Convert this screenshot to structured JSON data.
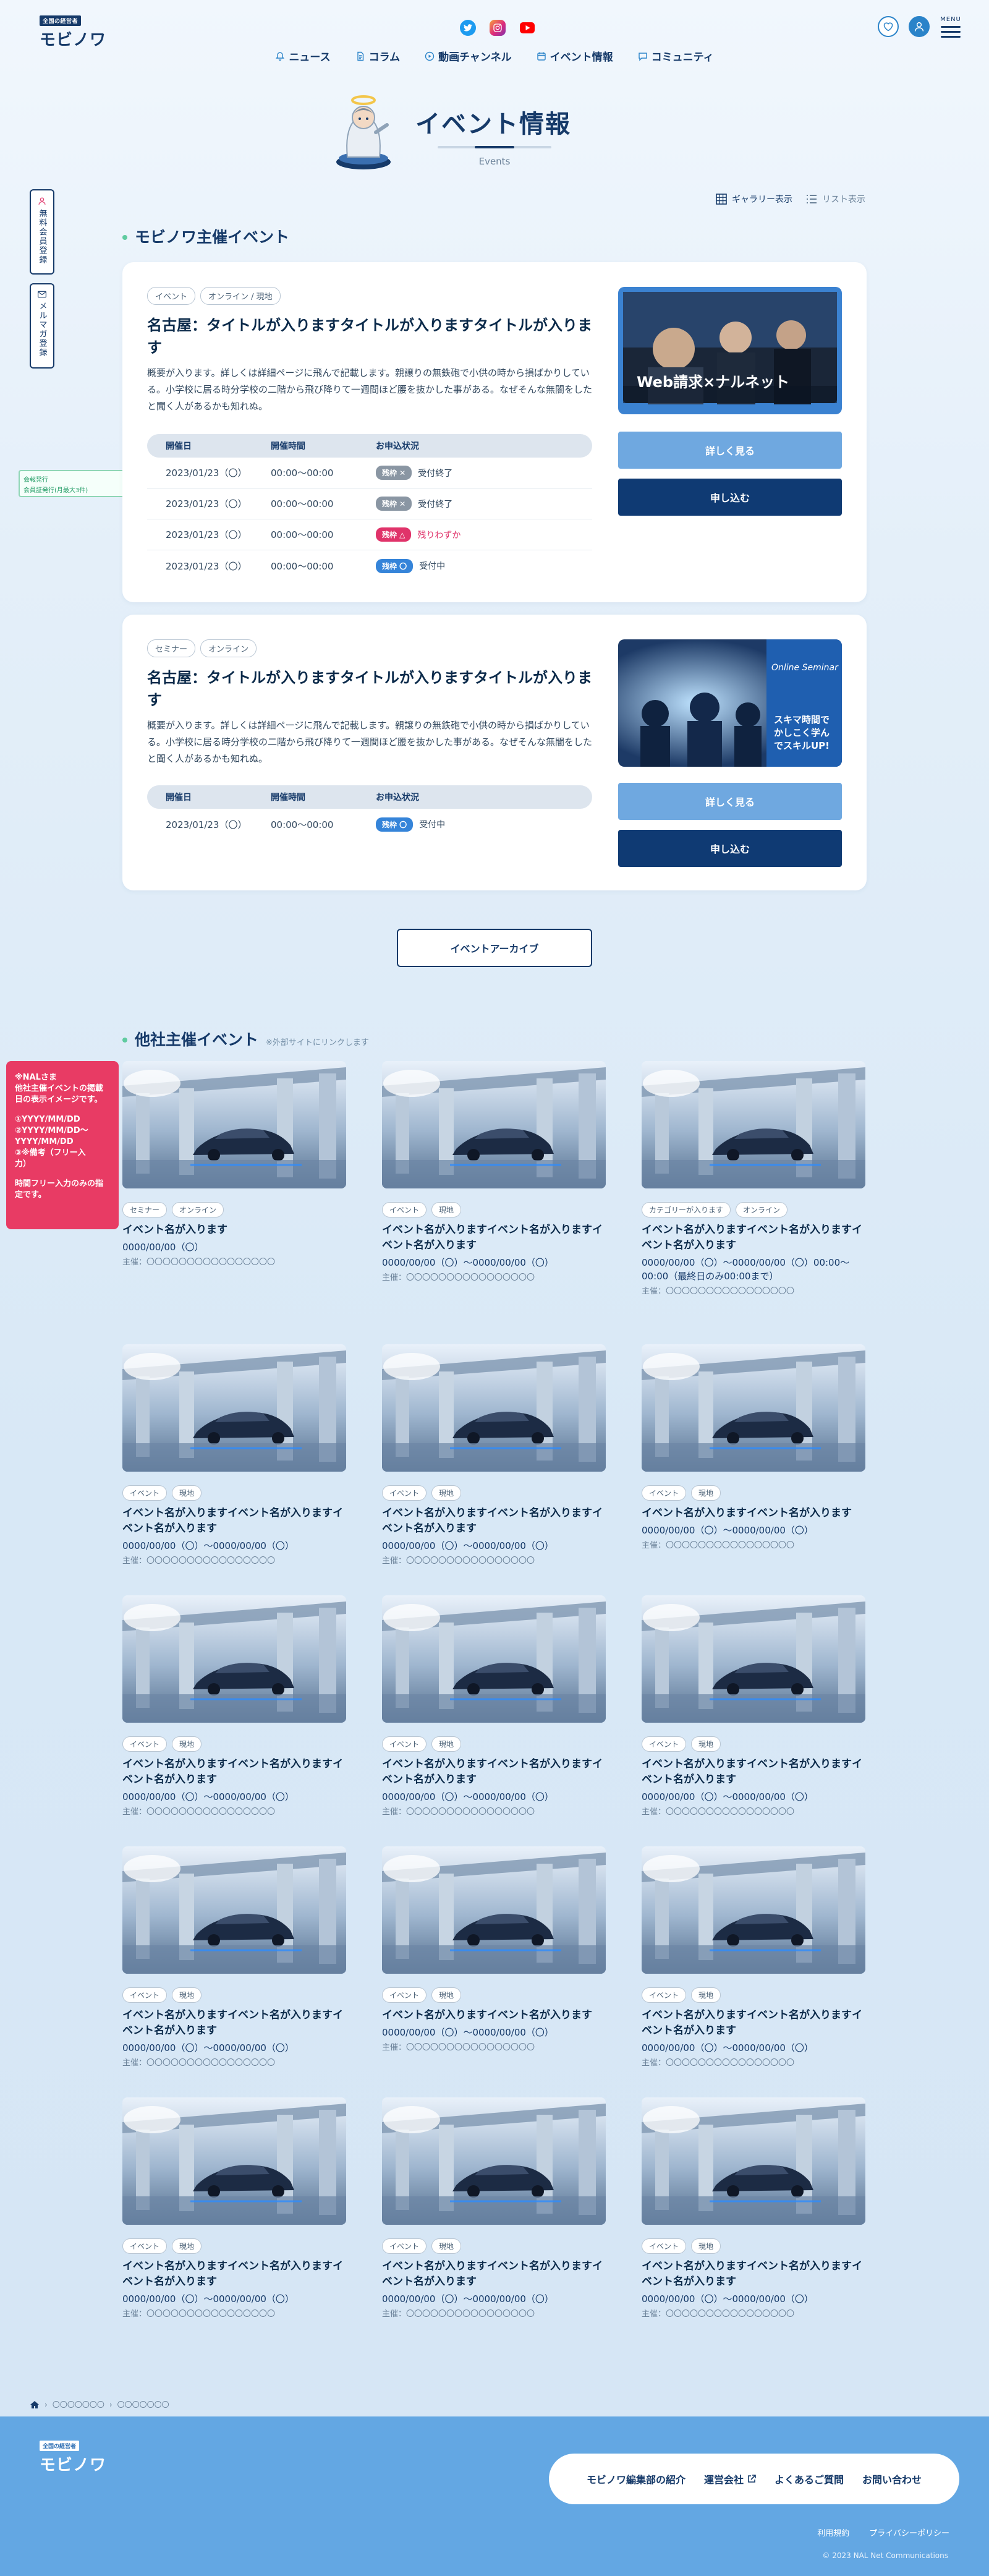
{
  "header": {
    "logo_small": "全国の経営者",
    "logo_main": "モビノワ",
    "nav": [
      "ニュース",
      "コラム",
      "動画チャンネル",
      "イベント情報",
      "コミュニティ"
    ],
    "menu_label": "MENU"
  },
  "hero": {
    "title": "イベント情報",
    "subtitle": "Events"
  },
  "side": {
    "tab1": "無料会員登録",
    "tab2": "メルマガ登録",
    "badge_line1": "会報発行",
    "badge_line2": "会員証発行(月最大3件)",
    "annotation": [
      "※NALさま",
      "他社主催イベントの掲載",
      "日の表示イメージです。",
      "",
      "①YYYY/MM/DD",
      "②YYYY/MM/DD〜",
      "YYYY/MM/DD",
      "③※備考（フリー入",
      "力）",
      "",
      "時間フリー入力のみの指",
      "定です。"
    ]
  },
  "view_toggle": {
    "gallery": "ギャラリー表示",
    "list": "リスト表示"
  },
  "own_events": {
    "heading": "モビノワ主催イベント",
    "detail_label": "詳しく見る",
    "apply_label": "申し込む",
    "table_headers": [
      "開催日",
      "開催時間",
      "お申込状況"
    ],
    "events": [
      {
        "tags": [
          "イベント",
          "オンライン / 現地"
        ],
        "title": "名古屋：タイトルが入りますタイトルが入りますタイトルが入ります",
        "description": "概要が入ります。詳しくは詳細ページに飛んで記載します。親譲りの無鉄砲で小供の時から損ばかりしている。小学校に居る時分学校の二階から飛び降りて一週間ほど腰を抜かした事がある。なぜそんな無闇をしたと聞く人があるかも知れぬ。",
        "image_text": "Web請求×ナルネット",
        "rows": [
          {
            "date": "2023/01/23（〇）",
            "time": "00:00〜00:00",
            "badge": "残枠 ✕",
            "badge_color": "gray",
            "status": "受付終了"
          },
          {
            "date": "2023/01/23（〇）",
            "time": "00:00〜00:00",
            "badge": "残枠 ✕",
            "badge_color": "gray",
            "status": "受付終了"
          },
          {
            "date": "2023/01/23（〇）",
            "time": "00:00〜00:00",
            "badge": "残枠 △",
            "badge_color": "red",
            "status": "残りわずか"
          },
          {
            "date": "2023/01/23（〇）",
            "time": "00:00〜00:00",
            "badge": "残枠 〇",
            "badge_color": "blue",
            "status": "受付中"
          }
        ]
      },
      {
        "tags": [
          "セミナー",
          "オンライン"
        ],
        "title": "名古屋：タイトルが入りますタイトルが入りますタイトルが入ります",
        "description": "概要が入ります。詳しくは詳細ページに飛んで記載します。親譲りの無鉄砲で小供の時から損ばかりしている。小学校に居る時分学校の二階から飛び降りて一週間ほど腰を抜かした事がある。なぜそんな無闇をしたと聞く人があるかも知れぬ。",
        "image_text_top": "Online Seminar",
        "image_text": "スキマ時間でかしこく学んでスキルUP!",
        "rows": [
          {
            "date": "2023/01/23（〇）",
            "time": "00:00〜00:00",
            "badge": "残枠 〇",
            "badge_color": "blue",
            "status": "受付中"
          }
        ]
      }
    ],
    "archive_label": "イベントアーカイブ"
  },
  "external_events": {
    "heading": "他社主催イベント",
    "note": "※外部サイトにリンクします",
    "cards": [
      {
        "tags": [
          "セミナー",
          "オンライン"
        ],
        "title": "イベント名が入ります",
        "date": "0000/00/00（〇）",
        "org": "主催：〇〇〇〇〇〇〇〇〇〇〇〇〇〇〇〇"
      },
      {
        "tags": [
          "イベント",
          "現地"
        ],
        "title": "イベント名が入りますイベント名が入りますイベント名が入ります",
        "date": "0000/00/00（〇）〜0000/00/00（〇）",
        "org": "主催：〇〇〇〇〇〇〇〇〇〇〇〇〇〇〇〇"
      },
      {
        "tags": [
          "カテゴリーが入ります",
          "オンライン"
        ],
        "title": "イベント名が入りますイベント名が入りますイベント名が入ります",
        "date": "0000/00/00（〇）〜0000/00/00（〇）00:00〜00:00（最終日のみ00:00まで）",
        "org": "主催：〇〇〇〇〇〇〇〇〇〇〇〇〇〇〇〇"
      },
      {
        "tags": [
          "イベント",
          "現地"
        ],
        "title": "イベント名が入りますイベント名が入りますイベント名が入ります",
        "date": "0000/00/00（〇）〜0000/00/00（〇）",
        "org": "主催：〇〇〇〇〇〇〇〇〇〇〇〇〇〇〇〇"
      },
      {
        "tags": [
          "イベント",
          "現地"
        ],
        "title": "イベント名が入りますイベント名が入りますイベント名が入ります",
        "date": "0000/00/00（〇）〜0000/00/00（〇）",
        "org": "主催：〇〇〇〇〇〇〇〇〇〇〇〇〇〇〇〇"
      },
      {
        "tags": [
          "イベント",
          "現地"
        ],
        "title": "イベント名が入りますイベント名が入ります",
        "date": "0000/00/00（〇）〜0000/00/00（〇）",
        "org": "主催：〇〇〇〇〇〇〇〇〇〇〇〇〇〇〇〇"
      },
      {
        "tags": [
          "イベント",
          "現地"
        ],
        "title": "イベント名が入りますイベント名が入りますイベント名が入ります",
        "date": "0000/00/00（〇）〜0000/00/00（〇）",
        "org": "主催：〇〇〇〇〇〇〇〇〇〇〇〇〇〇〇〇"
      },
      {
        "tags": [
          "イベント",
          "現地"
        ],
        "title": "イベント名が入りますイベント名が入りますイベント名が入ります",
        "date": "0000/00/00（〇）〜0000/00/00（〇）",
        "org": "主催：〇〇〇〇〇〇〇〇〇〇〇〇〇〇〇〇"
      },
      {
        "tags": [
          "イベント",
          "現地"
        ],
        "title": "イベント名が入りますイベント名が入りますイベント名が入ります",
        "date": "0000/00/00（〇）〜0000/00/00（〇）",
        "org": "主催：〇〇〇〇〇〇〇〇〇〇〇〇〇〇〇〇"
      },
      {
        "tags": [
          "イベント",
          "現地"
        ],
        "title": "イベント名が入りますイベント名が入りますイベント名が入ります",
        "date": "0000/00/00（〇）〜0000/00/00（〇）",
        "org": "主催：〇〇〇〇〇〇〇〇〇〇〇〇〇〇〇〇"
      },
      {
        "tags": [
          "イベント",
          "現地"
        ],
        "title": "イベント名が入りますイベント名が入ります",
        "date": "0000/00/00（〇）〜0000/00/00（〇）",
        "org": "主催：〇〇〇〇〇〇〇〇〇〇〇〇〇〇〇〇"
      },
      {
        "tags": [
          "イベント",
          "現地"
        ],
        "title": "イベント名が入りますイベント名が入りますイベント名が入ります",
        "date": "0000/00/00（〇）〜0000/00/00（〇）",
        "org": "主催：〇〇〇〇〇〇〇〇〇〇〇〇〇〇〇〇"
      },
      {
        "tags": [
          "イベント",
          "現地"
        ],
        "title": "イベント名が入りますイベント名が入りますイベント名が入ります",
        "date": "0000/00/00（〇）〜0000/00/00（〇）",
        "org": "主催：〇〇〇〇〇〇〇〇〇〇〇〇〇〇〇〇"
      },
      {
        "tags": [
          "イベント",
          "現地"
        ],
        "title": "イベント名が入りますイベント名が入りますイベント名が入ります",
        "date": "0000/00/00（〇）〜0000/00/00（〇）",
        "org": "主催：〇〇〇〇〇〇〇〇〇〇〇〇〇〇〇〇"
      },
      {
        "tags": [
          "イベント",
          "現地"
        ],
        "title": "イベント名が入りますイベント名が入りますイベント名が入ります",
        "date": "0000/00/00（〇）〜0000/00/00（〇）",
        "org": "主催：〇〇〇〇〇〇〇〇〇〇〇〇〇〇〇〇"
      }
    ]
  },
  "breadcrumb": [
    "〇〇〇〇〇〇〇",
    "〇〇〇〇〇〇〇"
  ],
  "footer": {
    "logo_small": "全国の経営者",
    "logo_main": "モビノワ",
    "links": [
      "モビノワ編集部の紹介",
      "運営会社",
      "よくあるご質問",
      "お問い合わせ"
    ],
    "sub_links": [
      "利用規約",
      "プライバシーポリシー"
    ],
    "copyright": "© 2023 NAL Net Communications"
  },
  "colors": {
    "navy": "#163a69",
    "accent_green": "#5fcba0",
    "button_blue": "#6fa8e0",
    "button_navy": "#0f3a73",
    "alert_red": "#e0336a"
  }
}
